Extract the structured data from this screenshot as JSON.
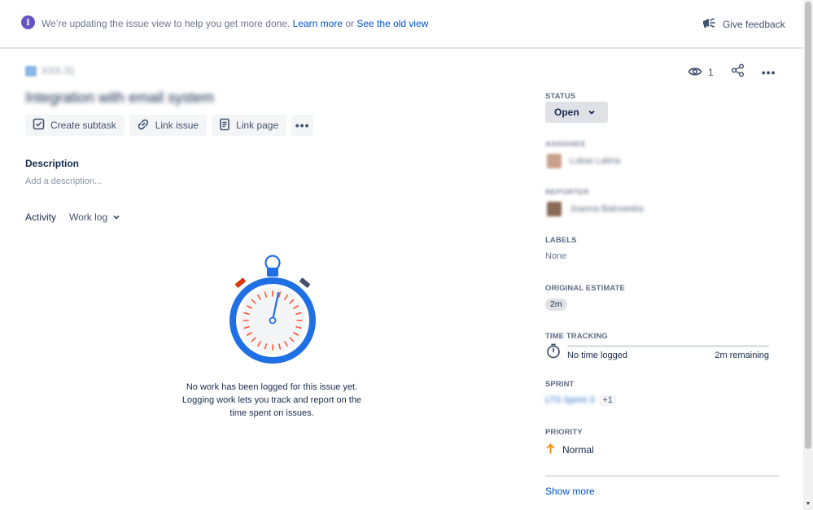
{
  "banner": {
    "text": "We’re updating the issue view to help you get more done.",
    "learn_more": "Learn more",
    "or": "or",
    "old_view": "See the old view",
    "feedback": "Give feedback"
  },
  "breadcrumb": {
    "issue_key": "XXX-31"
  },
  "issue": {
    "title": "Integration with email system"
  },
  "actions": {
    "create_subtask": "Create subtask",
    "link_issue": "Link issue",
    "link_page": "Link page",
    "more": "•••"
  },
  "description": {
    "label": "Description",
    "placeholder": "Add a description..."
  },
  "activity": {
    "label": "Activity",
    "selected": "Work log"
  },
  "empty_state": {
    "line1": "No work has been logged for this issue yet.",
    "line2": "Logging work lets you track and report on the",
    "line3": "time spent on issues."
  },
  "header_actions": {
    "watchers": "1",
    "more": "•••"
  },
  "sidebar": {
    "status_label": "STATUS",
    "status_value": "Open",
    "assignee_label": "ASSIGNEE",
    "assignee_name": "Lukas Latina",
    "reporter_label": "REPORTER",
    "reporter_name": "Joanna Batrowska",
    "labels_label": "LABELS",
    "labels_value": "None",
    "estimate_label": "ORIGINAL ESTIMATE",
    "estimate_value": "2m",
    "tracking_label": "TIME TRACKING",
    "tracking_logged": "No time logged",
    "tracking_remaining": "2m remaining",
    "sprint_label": "SPRINT",
    "sprint_name": "LTS Sprint 3",
    "sprint_more": "+1",
    "priority_label": "PRIORITY",
    "priority_value": "Normal",
    "show_more": "Show more"
  },
  "colors": {
    "accent": "#0052cc",
    "priority": "#ff8b00",
    "info": "#6554c0",
    "stopwatch_ring": "#1f6fe5",
    "stopwatch_ticks": "#ff5630"
  }
}
